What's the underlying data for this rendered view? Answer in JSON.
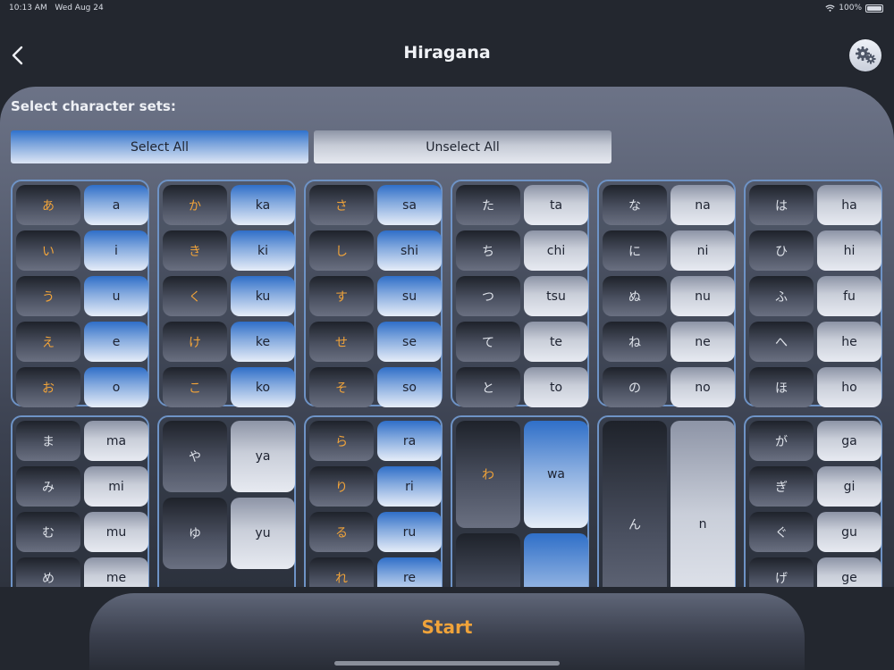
{
  "status_bar": {
    "time": "10:13 AM",
    "date": "Wed Aug 24",
    "battery": "100%"
  },
  "header": {
    "title": "Hiragana"
  },
  "prompt": "Select character sets:",
  "buttons": {
    "select_all": "Select All",
    "unselect_all": "Unselect All",
    "start": "Start"
  },
  "accent_color": "#f0a33a",
  "selected_color": "#2f6fc8",
  "groups": [
    {
      "selected": true,
      "rows": [
        [
          "あ",
          "a"
        ],
        [
          "い",
          "i"
        ],
        [
          "う",
          "u"
        ],
        [
          "え",
          "e"
        ],
        [
          "お",
          "o"
        ]
      ]
    },
    {
      "selected": true,
      "rows": [
        [
          "か",
          "ka"
        ],
        [
          "き",
          "ki"
        ],
        [
          "く",
          "ku"
        ],
        [
          "け",
          "ke"
        ],
        [
          "こ",
          "ko"
        ]
      ]
    },
    {
      "selected": true,
      "rows": [
        [
          "さ",
          "sa"
        ],
        [
          "し",
          "shi"
        ],
        [
          "す",
          "su"
        ],
        [
          "せ",
          "se"
        ],
        [
          "そ",
          "so"
        ]
      ]
    },
    {
      "selected": false,
      "rows": [
        [
          "た",
          "ta"
        ],
        [
          "ち",
          "chi"
        ],
        [
          "つ",
          "tsu"
        ],
        [
          "て",
          "te"
        ],
        [
          "と",
          "to"
        ]
      ]
    },
    {
      "selected": false,
      "rows": [
        [
          "な",
          "na"
        ],
        [
          "に",
          "ni"
        ],
        [
          "ぬ",
          "nu"
        ],
        [
          "ね",
          "ne"
        ],
        [
          "の",
          "no"
        ]
      ]
    },
    {
      "selected": false,
      "rows": [
        [
          "は",
          "ha"
        ],
        [
          "ひ",
          "hi"
        ],
        [
          "ふ",
          "fu"
        ],
        [
          "へ",
          "he"
        ],
        [
          "ほ",
          "ho"
        ]
      ]
    },
    {
      "selected": false,
      "rows": [
        [
          "ま",
          "ma"
        ],
        [
          "み",
          "mi"
        ],
        [
          "む",
          "mu"
        ],
        [
          "め",
          "me"
        ]
      ]
    },
    {
      "selected": false,
      "rows": [
        [
          "や",
          "ya"
        ],
        [
          "ゆ",
          "yu"
        ]
      ]
    },
    {
      "selected": true,
      "rows": [
        [
          "ら",
          "ra"
        ],
        [
          "り",
          "ri"
        ],
        [
          "る",
          "ru"
        ],
        [
          "れ",
          "re"
        ]
      ]
    },
    {
      "selected": true,
      "rows": [
        [
          "わ",
          "wa"
        ]
      ]
    },
    {
      "selected": false,
      "rows": [
        [
          "ん",
          "n"
        ]
      ]
    },
    {
      "selected": false,
      "rows": [
        [
          "が",
          "ga"
        ],
        [
          "ぎ",
          "gi"
        ],
        [
          "ぐ",
          "gu"
        ],
        [
          "げ",
          "ge"
        ]
      ]
    }
  ]
}
